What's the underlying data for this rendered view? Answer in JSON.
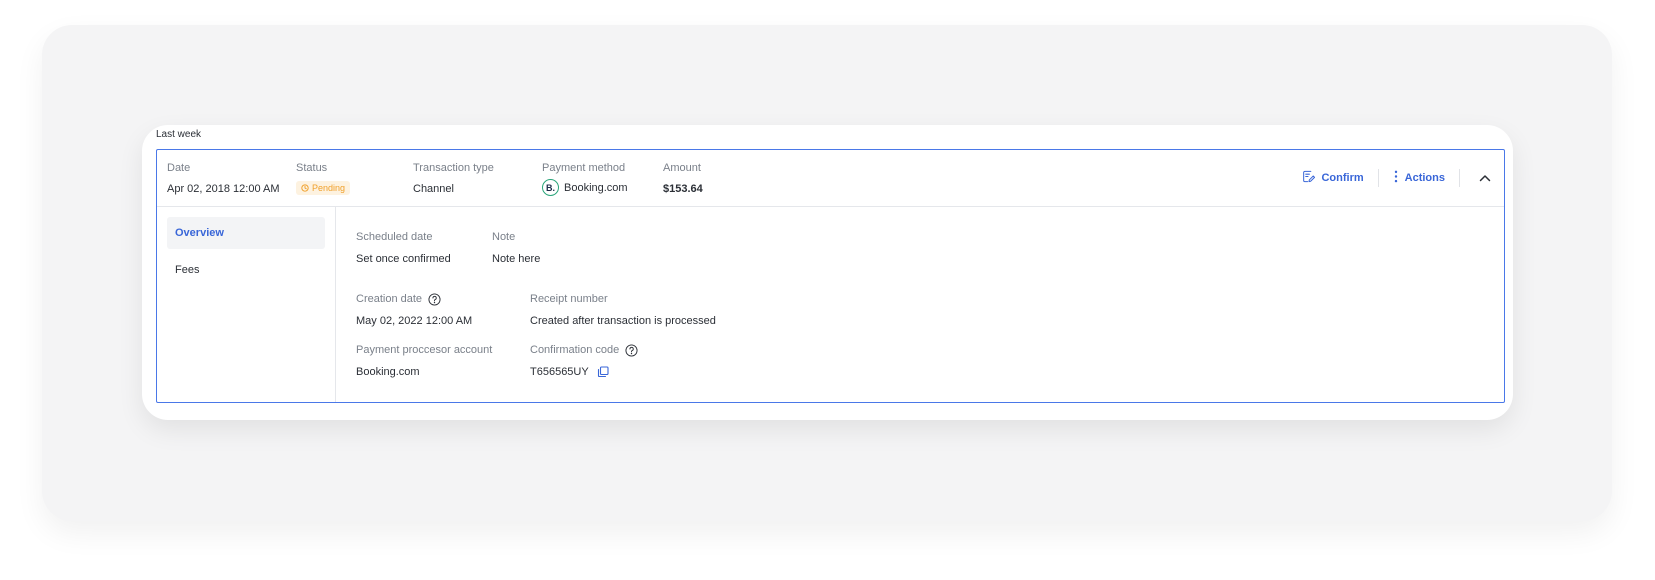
{
  "group": {
    "label": "Last week"
  },
  "transaction": {
    "date": {
      "label": "Date",
      "value": "Apr 02, 2018 12:00 AM"
    },
    "status": {
      "label": "Status",
      "value": "Pending",
      "color": "#f0a02b"
    },
    "type": {
      "label": "Transaction type",
      "value": "Channel"
    },
    "payment_method": {
      "label": "Payment method",
      "logo_letter": "B.",
      "value": "Booking.com"
    },
    "amount": {
      "label": "Amount",
      "value": "$153.64"
    }
  },
  "actions": {
    "confirm_label": "Confirm",
    "actions_label": "Actions"
  },
  "sidebar": {
    "items": [
      {
        "label": "Overview",
        "active": true
      },
      {
        "label": "Fees",
        "active": false
      }
    ]
  },
  "details": {
    "scheduled_date": {
      "label": "Scheduled date",
      "value": "Set once confirmed"
    },
    "note": {
      "label": "Note",
      "value": "Note here"
    },
    "creation_date": {
      "label": "Creation date",
      "value": "May 02, 2022 12:00 AM"
    },
    "receipt_number": {
      "label": "Receipt number",
      "value": "Created after transaction is processed"
    },
    "processor_account": {
      "label": "Payment proccesor account",
      "value": "Booking.com"
    },
    "confirmation_code": {
      "label": "Confirmation code",
      "value": "T656565UY"
    }
  },
  "colors": {
    "accent": "#3966d8",
    "border_active": "#4a78e8",
    "pending_bg": "#fdf2e0",
    "pending_fg": "#f0a02b",
    "booking_ring": "#2aa57a"
  },
  "icons": {
    "status": "clock-icon",
    "confirm": "edit-check-icon",
    "actions": "more-vertical-icon",
    "collapse": "chevron-up-icon",
    "help": "question-circle-icon",
    "copy": "copy-icon"
  }
}
